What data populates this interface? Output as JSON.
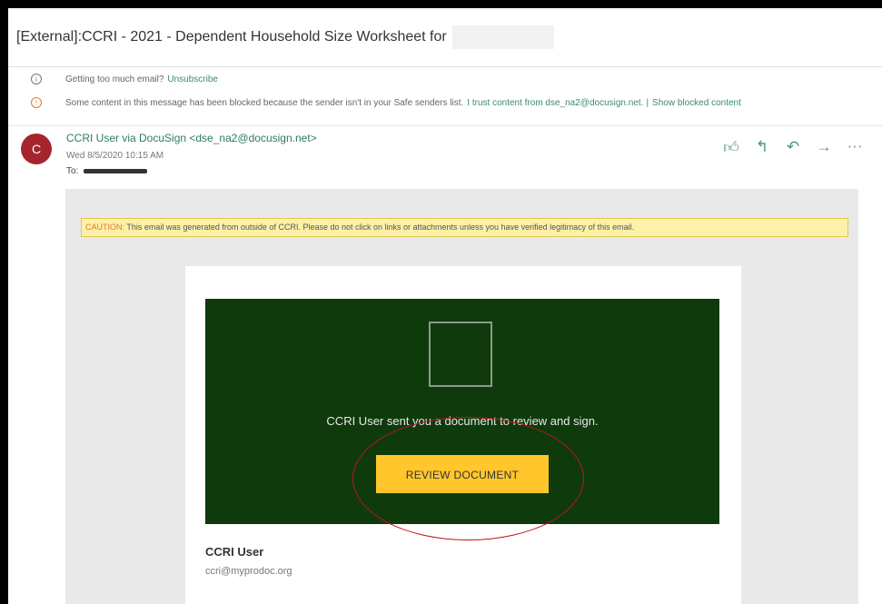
{
  "subject": "[External]:CCRI - 2021 - Dependent Household Size Worksheet for",
  "notices": {
    "unsubscribe": {
      "text": "Getting too much email?",
      "link": "Unsubscribe"
    },
    "blocked": {
      "text": "Some content in this message has been blocked because the sender isn't in your Safe senders list.",
      "trust_link": "I trust content from dse_na2@docusign.net.",
      "separator": "|",
      "show_link": "Show blocked content"
    }
  },
  "email": {
    "avatar_initial": "C",
    "sender": "CCRI User via DocuSign <dse_na2@docusign.net>",
    "date": "Wed 8/5/2020 10:15 AM",
    "to_label": "To:"
  },
  "actions": {
    "like": "like-icon",
    "reply": "reply-icon",
    "reply_all": "reply-all-icon",
    "forward": "forward-icon",
    "more": "more-icon"
  },
  "caution": {
    "tag": "CAUTION:",
    "text": "This email was generated from outside of CCRI. Please do not click on links or attachments unless you have verified legitimacy of this email."
  },
  "docusign": {
    "message": "CCRI User sent you a document to review and sign.",
    "button": "REVIEW DOCUMENT",
    "signer_name": "CCRI User",
    "signer_email": "ccri@myprodoc.org"
  },
  "colors": {
    "panel_green": "#0f3b0c",
    "button_yellow": "#ffc72c",
    "highlight_ellipse": "#c1121f",
    "avatar": "#a4262c"
  }
}
